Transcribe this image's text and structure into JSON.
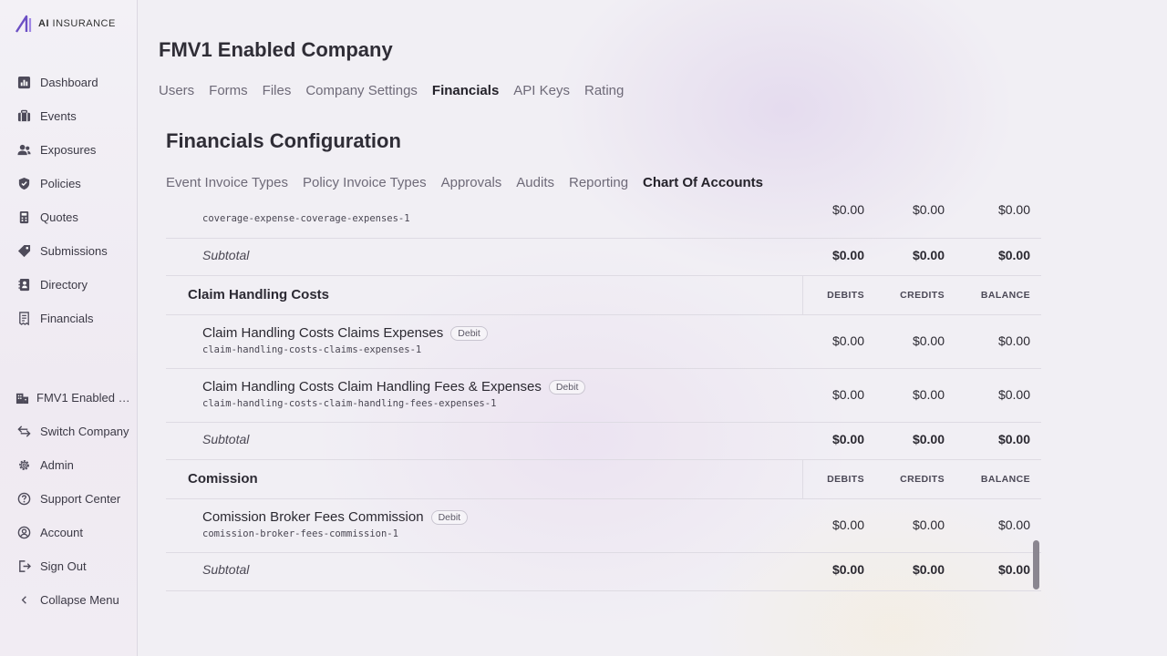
{
  "brand": {
    "logo_bold": "AI",
    "logo_rest": " INSURANCE"
  },
  "sidebar": {
    "items": [
      {
        "label": "Dashboard",
        "icon": "chart-bar-icon"
      },
      {
        "label": "Events",
        "icon": "briefcase-icon"
      },
      {
        "label": "Exposures",
        "icon": "users-icon"
      },
      {
        "label": "Policies",
        "icon": "shield-icon"
      },
      {
        "label": "Quotes",
        "icon": "calculator-icon"
      },
      {
        "label": "Submissions",
        "icon": "tag-icon"
      },
      {
        "label": "Directory",
        "icon": "address-book-icon"
      },
      {
        "label": "Financials",
        "icon": "receipt-icon"
      }
    ],
    "bottom_items": [
      {
        "label": "FMV1 Enabled …",
        "icon": "building-icon"
      },
      {
        "label": "Switch Company",
        "icon": "switch-arrows-icon"
      },
      {
        "label": "Admin",
        "icon": "gear-icon"
      },
      {
        "label": "Support Center",
        "icon": "question-circle-icon"
      },
      {
        "label": "Account",
        "icon": "user-circle-icon"
      },
      {
        "label": "Sign Out",
        "icon": "sign-out-icon"
      },
      {
        "label": "Collapse Menu",
        "icon": "chevron-left-icon"
      }
    ]
  },
  "header": {
    "company_title": "FMV1 Enabled Company"
  },
  "company_tabs": [
    "Users",
    "Forms",
    "Files",
    "Company Settings",
    "Financials",
    "API Keys",
    "Rating"
  ],
  "company_tab_active": "Financials",
  "config": {
    "title": "Financials Configuration"
  },
  "config_tabs": [
    "Event Invoice Types",
    "Policy Invoice Types",
    "Approvals",
    "Audits",
    "Reporting",
    "Chart Of Accounts"
  ],
  "config_tab_active": "Chart Of Accounts",
  "table": {
    "col_headers": {
      "debits": "DEBITS",
      "credits": "CREDITS",
      "balance": "BALANCE"
    },
    "top_partial": {
      "code": "coverage-expense-coverage-expenses-1",
      "debits": "$0.00",
      "credits": "$0.00",
      "balance": "$0.00"
    },
    "subtotal_label": "Subtotal",
    "subtotal_1": {
      "debits": "$0.00",
      "credits": "$0.00",
      "balance": "$0.00"
    },
    "group_claim": {
      "title": "Claim Handling Costs",
      "rows": [
        {
          "name": "Claim Handling Costs Claims Expenses",
          "badge": "Debit",
          "code": "claim-handling-costs-claims-expenses-1",
          "debits": "$0.00",
          "credits": "$0.00",
          "balance": "$0.00"
        },
        {
          "name": "Claim Handling Costs Claim Handling Fees & Expenses",
          "badge": "Debit",
          "code": "claim-handling-costs-claim-handling-fees-expenses-1",
          "debits": "$0.00",
          "credits": "$0.00",
          "balance": "$0.00"
        }
      ],
      "subtotal": {
        "debits": "$0.00",
        "credits": "$0.00",
        "balance": "$0.00"
      }
    },
    "group_comission": {
      "title": "Comission",
      "rows": [
        {
          "name": "Comission Broker Fees Commission",
          "badge": "Debit",
          "code": "comission-broker-fees-commission-1",
          "debits": "$0.00",
          "credits": "$0.00",
          "balance": "$0.00"
        }
      ],
      "subtotal": {
        "debits": "$0.00",
        "credits": "$0.00",
        "balance": "$0.00"
      }
    }
  }
}
